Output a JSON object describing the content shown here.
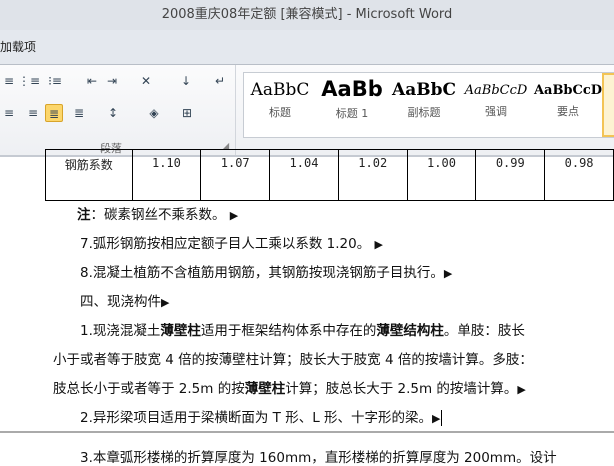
{
  "window": {
    "title": "2008重庆08年定额 [兼容模式] - Microsoft Word"
  },
  "tabs": {
    "partial_tab": "加载项"
  },
  "ribbon": {
    "paragraph_group": "段落",
    "styles": [
      {
        "sample": "AaBbC",
        "label": "标题"
      },
      {
        "sample": "AaBb",
        "label": "标题 1"
      },
      {
        "sample": "AaBbC",
        "label": "副标题"
      },
      {
        "sample": "AaBbCcD",
        "label": "强调"
      },
      {
        "sample": "AaBbCcD",
        "label": "要点"
      }
    ]
  },
  "document": {
    "table_row": {
      "label": "钢筋系数",
      "values": [
        "1.10",
        "1.07",
        "1.04",
        "1.02",
        "1.00",
        "0.99",
        "0.98"
      ]
    },
    "note_label": "注",
    "note_text": "：碳素钢丝不乘系数。",
    "item7": "7.弧形钢筋按相应定额子目人工乘以系数 1.20。",
    "item8": "8.混凝土植筋不含植筋用钢筋，其钢筋按现浇钢筋子目执行。",
    "section4": "四、现浇构件",
    "p1_a": "1.现浇混凝土",
    "p1_b": "薄壁柱",
    "p1_c": "适用于框架结构体系中存在的",
    "p1_d": "薄壁结构柱",
    "p1_e": "。单肢：肢长",
    "p1_line2": "小于或者等于肢宽 4 倍的按薄壁柱计算；肢长大于肢宽 4 倍的按墙计算。多肢：",
    "p1_line3_a": "肢总长小于或者等于 2.5m 的按",
    "p1_line3_b": "薄壁柱",
    "p1_line3_c": "计算；肢总长大于 2.5m 的按墙计算。",
    "item2": "2.异形梁项目适用于梁横断面为 T 形、L 形、十字形的梁。",
    "item3_partial": "3.本章弧形楼梯的折算厚度为 160mm，直形楼梯的折算厚度为 200mm。设计"
  }
}
